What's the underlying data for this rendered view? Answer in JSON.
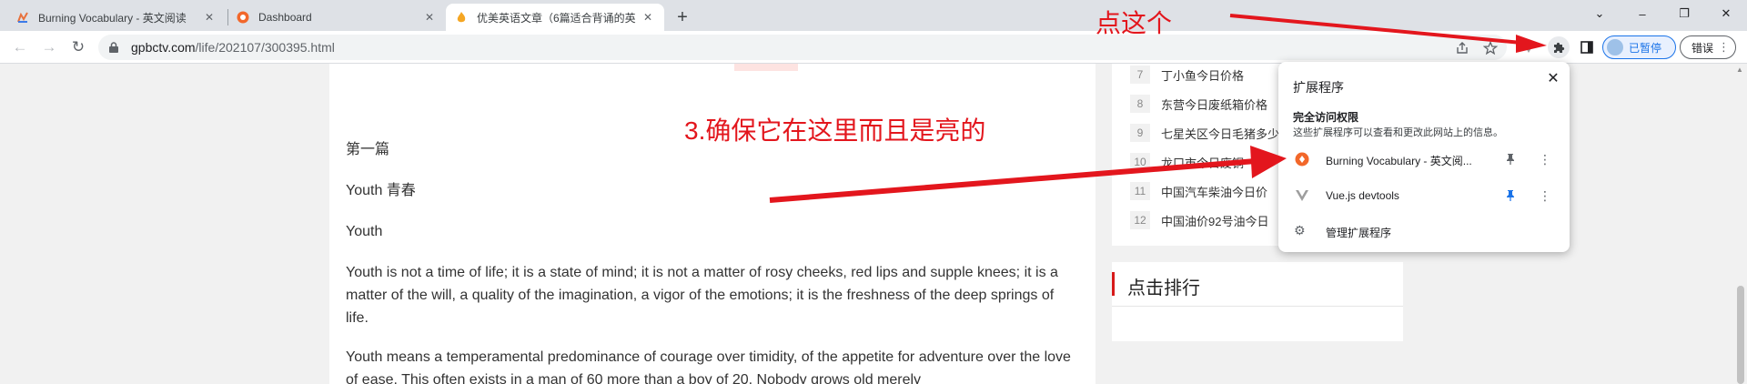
{
  "tabs": [
    {
      "title": "Burning Vocabulary - 英文阅读",
      "close": "✕"
    },
    {
      "title": "Dashboard",
      "close": "✕"
    },
    {
      "title": "优美英语文章（6篇适合背诵的英",
      "close": "✕"
    }
  ],
  "new_tab": "+",
  "window_controls": {
    "minimize": "–",
    "maximize": "❐",
    "close": "✕",
    "tab_search": "⌄"
  },
  "toolbar": {
    "back": "←",
    "forward": "→",
    "reload": "↻",
    "url_host": "gpbctv.com",
    "url_path": "/life/202107/300395.html",
    "profile_label": "已暂停",
    "error_label": "错误",
    "more": "⋮"
  },
  "article": {
    "paragraphs": [
      "第一篇",
      "Youth 青春",
      "Youth",
      "Youth is not a time of life; it is a state of mind; it is not a matter of rosy cheeks, red lips and supple knees; it is a matter of the will, a quality of the imagination, a vigor of the emotions; it is the freshness of the deep springs of life.",
      "Youth means a temperamental predominance of courage over timidity, of the appetite for adventure over the love of ease. This often exists in a man of 60 more than a boy of 20. Nobody grows old merely"
    ]
  },
  "sidebar": {
    "ranking": [
      {
        "num": "7",
        "text": "丁小鱼今日价格"
      },
      {
        "num": "8",
        "text": "东营今日废纸箱价格"
      },
      {
        "num": "9",
        "text": "七星关区今日毛猪多少"
      },
      {
        "num": "10",
        "text": "龙口市今日废铜"
      },
      {
        "num": "11",
        "text": "中国汽车柴油今日价"
      },
      {
        "num": "12",
        "text": "中国油价92号油今日"
      }
    ],
    "click_ranking_title": "点击排行"
  },
  "extensions_popup": {
    "title": "扩展程序",
    "close": "✕",
    "section_title": "完全访问权限",
    "section_desc": "这些扩展程序可以查看和更改此网站上的信息。",
    "items": [
      {
        "name": "Burning Vocabulary - 英文阅...",
        "pinned": true,
        "pin_color": "#5f6368"
      },
      {
        "name": "Vue.js devtools",
        "pinned": true,
        "pin_color": "#1a73e8"
      }
    ],
    "more": "⋮",
    "manage_label": "管理扩展程序"
  },
  "annotations": {
    "click_this": "点这个",
    "ensure_here": "3.确保它在这里而且是亮的",
    "color": "#e3161d"
  }
}
